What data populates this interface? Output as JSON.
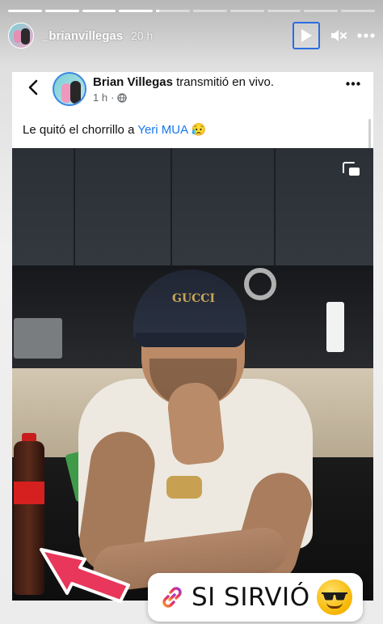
{
  "story": {
    "progress_segments": [
      1,
      1,
      1,
      1,
      0.1,
      0,
      0,
      0,
      0,
      0
    ],
    "username": "_brianvillegas",
    "time": "20 h"
  },
  "icons": {
    "play": "play-icon",
    "mute": "speaker-muted-icon",
    "more": "more-horizontal-icon"
  },
  "post": {
    "author": "Brian Villegas",
    "action": " transmitió en vivo.",
    "meta_time": "1 h",
    "meta_separator": " · ",
    "text_before": "Le quitó el chorrillo a ",
    "mention": "Yeri MUA",
    "emoji": "😥"
  },
  "video": {
    "cap_logo": "GUCCI"
  },
  "sticker": {
    "link_text": "SI SIRVIÓ",
    "emoji_name": "sunglasses-face-emoji"
  },
  "colors": {
    "accent_blue": "#1877f2",
    "play_border": "#2d6cdf",
    "arrow_red": "#e8375a"
  }
}
